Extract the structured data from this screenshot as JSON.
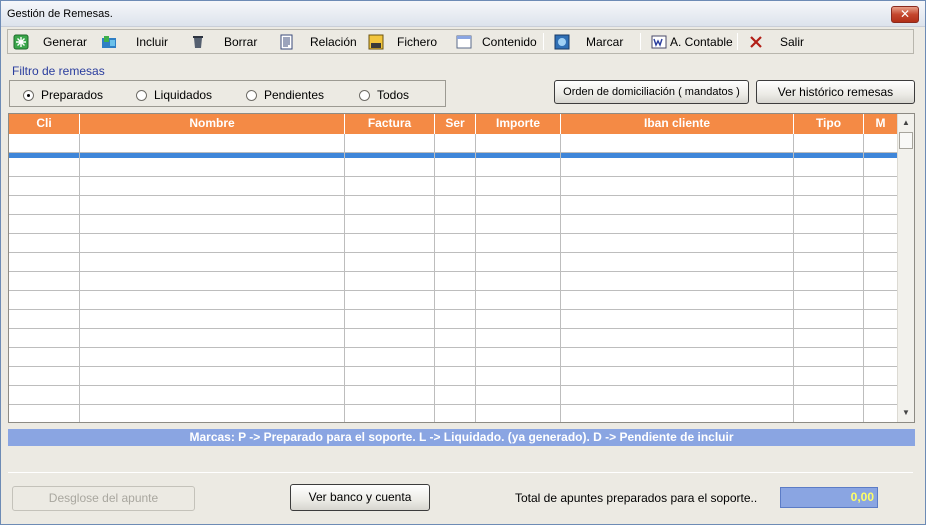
{
  "window": {
    "title": "Gestión de Remesas.",
    "close_glyph": "✕"
  },
  "toolbar": {
    "items": [
      {
        "label": "Generar",
        "icon": "generate-icon"
      },
      {
        "label": "Incluir",
        "icon": "include-icon"
      },
      {
        "label": "Borrar",
        "icon": "delete-icon"
      },
      {
        "label": "Relación",
        "icon": "list-icon"
      },
      {
        "label": "Fichero",
        "icon": "file-icon"
      },
      {
        "label": "Contenido",
        "icon": "window-icon"
      },
      {
        "label": "Marcar",
        "icon": "mark-icon"
      },
      {
        "label": "A. Contable",
        "icon": "accounting-icon"
      },
      {
        "label": "Salir",
        "icon": "exit-icon"
      }
    ]
  },
  "filter": {
    "label": "Filtro de remesas",
    "options": [
      {
        "label": "Preparados",
        "selected": true
      },
      {
        "label": "Liquidados",
        "selected": false
      },
      {
        "label": "Pendientes",
        "selected": false
      },
      {
        "label": "Todos",
        "selected": false
      }
    ]
  },
  "buttons": {
    "orden": "Orden de domiciliación ( mandatos )",
    "historico": "Ver histórico remesas",
    "desglose": "Desglose del apunte",
    "banco": "Ver banco y cuenta"
  },
  "grid": {
    "columns": [
      "Cli",
      "Nombre",
      "Factura",
      "Ser",
      "Importe",
      "Iban cliente",
      "Tipo",
      "M"
    ],
    "rows": []
  },
  "legend": "Marcas:  P -> Preparado para el soporte.  L ->  Liquidado. (ya generado).   D -> Pendiente de incluir",
  "total": {
    "label": "Total de apuntes preparados para el soporte..",
    "value": "0,00"
  },
  "colors": {
    "header": "#f48a45",
    "legend": "#8aa5e2",
    "selection": "#3f86d9",
    "total_text": "#ffff66"
  }
}
